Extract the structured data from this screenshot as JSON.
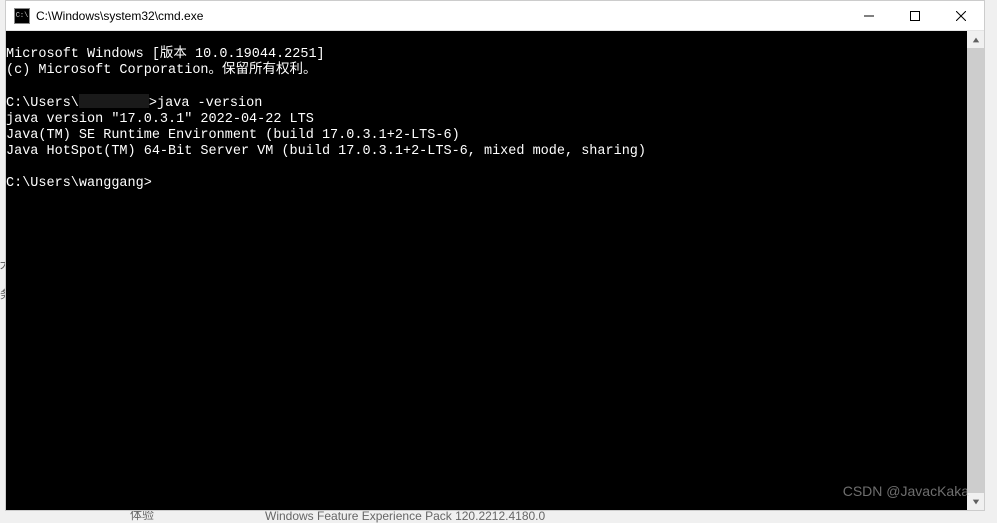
{
  "window": {
    "title": "C:\\Windows\\system32\\cmd.exe"
  },
  "terminal": {
    "lines": [
      "Microsoft Windows [版本 10.0.19044.2251]",
      "(c) Microsoft Corporation。保留所有权利。",
      "",
      "C:\\Users\\",
      ">java -version",
      "java version \"17.0.3.1\" 2022-04-22 LTS",
      "Java(TM) SE Runtime Environment (build 17.0.3.1+2-LTS-6)",
      "Java HotSpot(TM) 64-Bit Server VM (build 17.0.3.1+2-LTS-6, mixed mode, sharing)",
      "",
      "C:\\Users\\wanggang>"
    ]
  },
  "watermark": "CSDN @JavacKaka",
  "background": {
    "item1": "体验",
    "item2": "Windows Feature Experience Pack 120.2212.4180.0"
  },
  "leftstrip": {
    "c1": "犬",
    "c2": "务"
  }
}
